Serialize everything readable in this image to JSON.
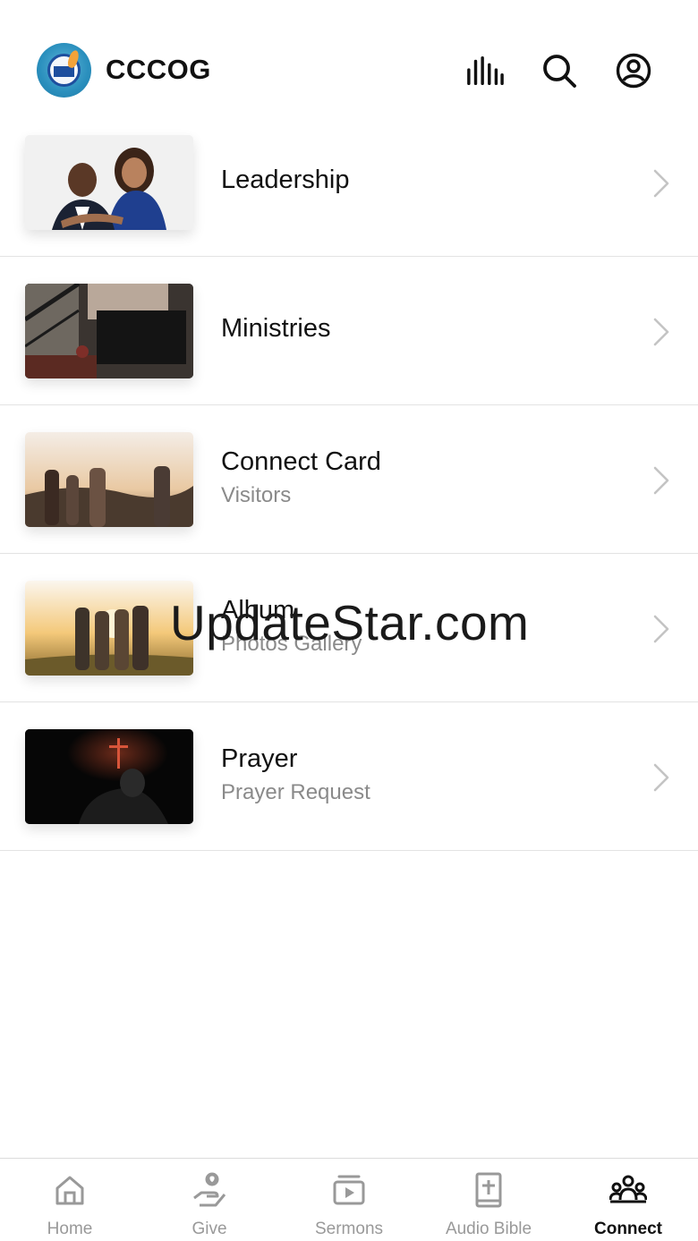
{
  "header": {
    "app_title": "CCCOG",
    "icons": [
      "bars-icon",
      "search-icon",
      "account-icon"
    ]
  },
  "list": {
    "items": [
      {
        "title": "Leadership",
        "subtitle": ""
      },
      {
        "title": "Ministries",
        "subtitle": ""
      },
      {
        "title": "Connect Card",
        "subtitle": "Visitors"
      },
      {
        "title": "Album",
        "subtitle": "Photos Gallery"
      },
      {
        "title": "Prayer",
        "subtitle": "Prayer Request"
      }
    ]
  },
  "watermark": "UpdateStar.com",
  "tabs": [
    {
      "label": "Home",
      "icon": "home-icon",
      "active": false
    },
    {
      "label": "Give",
      "icon": "give-icon",
      "active": false
    },
    {
      "label": "Sermons",
      "icon": "sermons-icon",
      "active": false
    },
    {
      "label": "Audio Bible",
      "icon": "bible-icon",
      "active": false
    },
    {
      "label": "Connect",
      "icon": "connect-icon",
      "active": true
    }
  ],
  "colors": {
    "active_tab": "#111111",
    "inactive_tab": "#999999",
    "divider": "#e3e3e3",
    "logo_blue": "#2a8fbd"
  }
}
